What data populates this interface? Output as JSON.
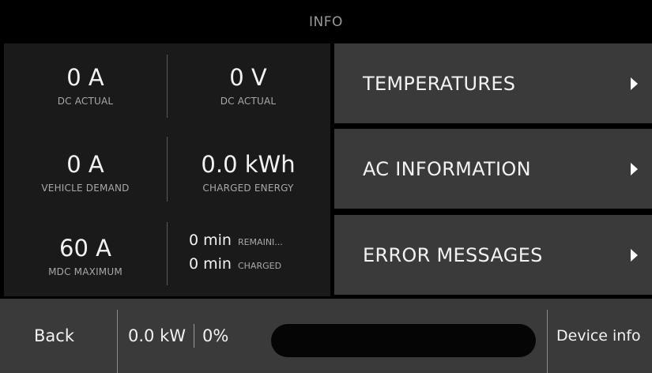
{
  "header": {
    "title": "INFO"
  },
  "stats": {
    "dc_current": {
      "value": "0 A",
      "label": "DC ACTUAL"
    },
    "dc_voltage": {
      "value": "0 V",
      "label": "DC ACTUAL"
    },
    "vehicle_demand": {
      "value": "0 A",
      "label": "VEHICLE DEMAND"
    },
    "charged_energy": {
      "value": "0.0 kWh",
      "label": "CHARGED ENERGY"
    },
    "mdc_maximum": {
      "value": "60 A",
      "label": "MDC MAXIMUM"
    },
    "remaining_time": {
      "value": "0 min",
      "label": "REMAINI..."
    },
    "charged_time": {
      "value": "0 min",
      "label": "CHARGED"
    }
  },
  "menu": {
    "temperatures": "TEMPERATURES",
    "ac_information": "AC INFORMATION",
    "error_messages": "ERROR MESSAGES"
  },
  "bottom_bar": {
    "back_label": "Back",
    "power": "0.0 kW",
    "percent": "0%",
    "progress_fraction": 0,
    "device_info_label": "Device info"
  },
  "colors": {
    "background": "#000000",
    "panel": "#1a1a1a",
    "button": "#3a3a3a",
    "progress_track": "#050505"
  }
}
